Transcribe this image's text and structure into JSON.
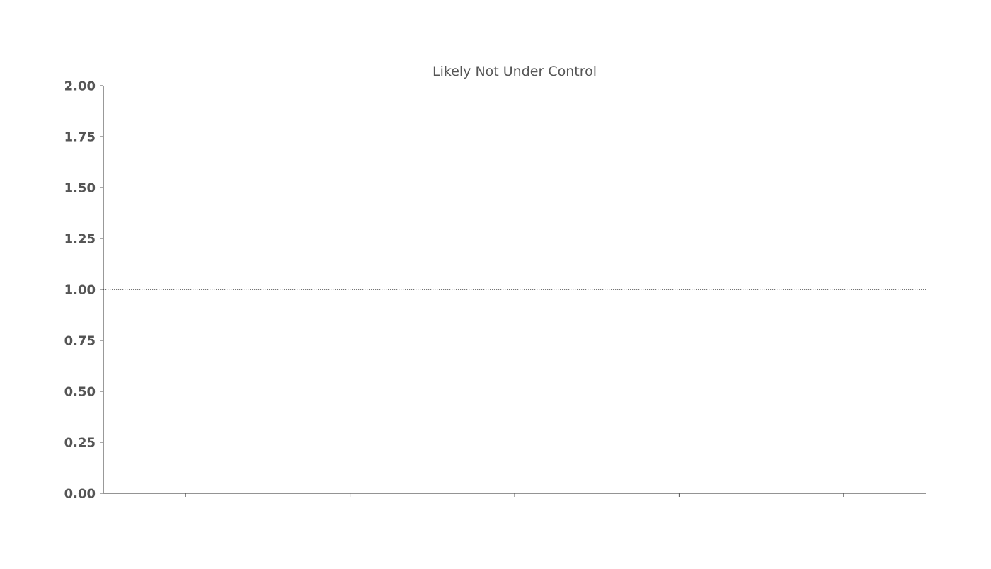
{
  "chart_data": {
    "type": "line",
    "title": "Likely Not Under Control",
    "xlabel": "",
    "ylabel": "",
    "ylim": [
      0,
      2
    ],
    "y_ticks": [
      0,
      0.25,
      0.5,
      0.75,
      1.0,
      1.25,
      1.5,
      1.75,
      2.0
    ],
    "y_tick_labels": [
      "0.00",
      "0.25",
      "0.50",
      "0.75",
      "1.00",
      "1.25",
      "1.50",
      "1.75",
      "2.00"
    ],
    "x_tick_count": 5,
    "x_tick_labels": [
      "",
      "",
      "",
      "",
      ""
    ],
    "reference_lines": [
      {
        "orientation": "horizontal",
        "y": 1.0,
        "style": "dotted",
        "color": "#222222"
      }
    ],
    "series": [],
    "grid": false,
    "legend": "none",
    "colors": {
      "axis": "#555555",
      "text": "#555555",
      "reference": "#222222"
    }
  }
}
